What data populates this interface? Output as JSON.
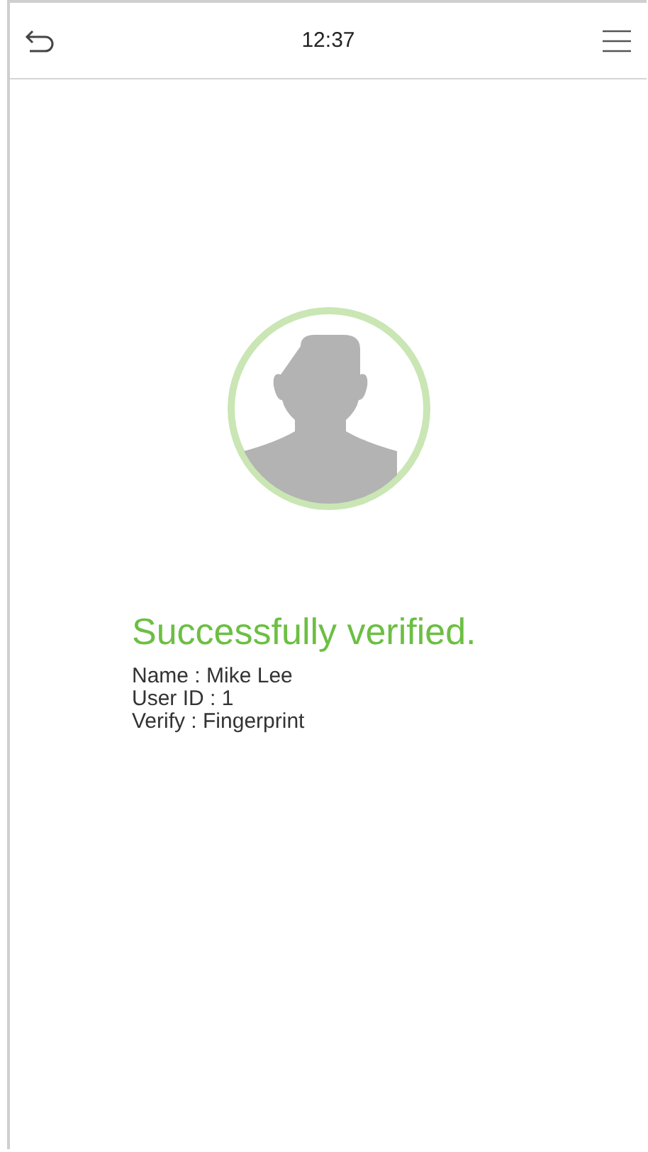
{
  "header": {
    "time": "12:37"
  },
  "result": {
    "message": "Successfully verified.",
    "details": [
      "Name : Mike Lee",
      "User ID : 1",
      "Verify : Fingerprint"
    ]
  }
}
